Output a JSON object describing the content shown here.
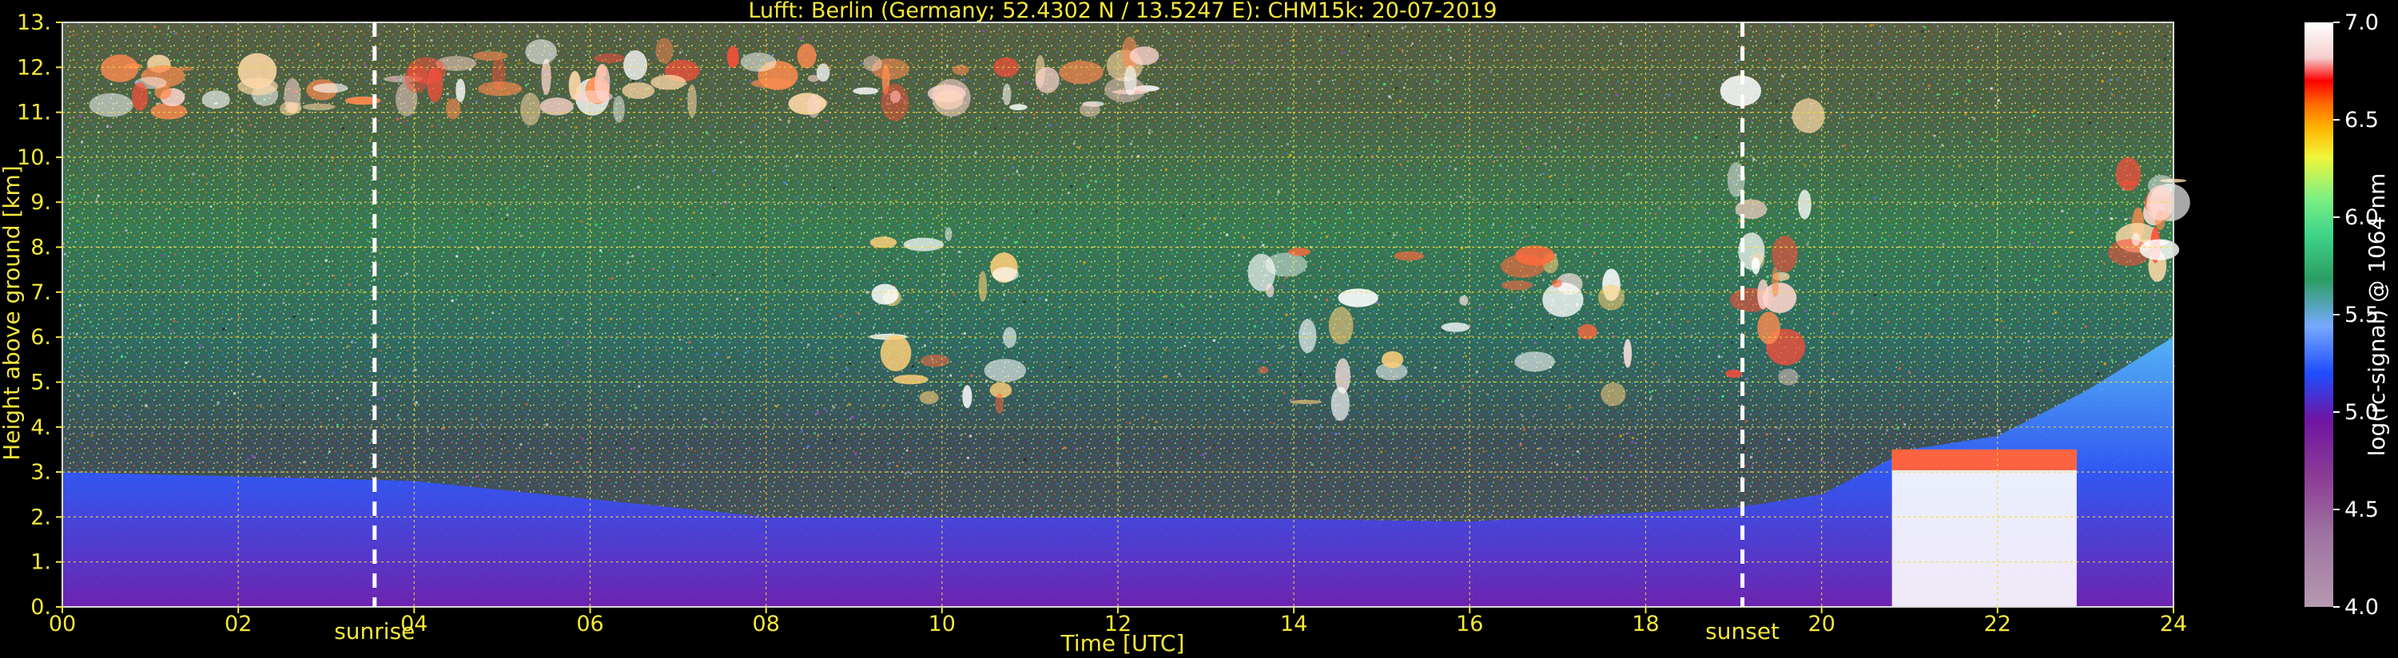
{
  "chart_data": {
    "type": "heatmap",
    "title": "Lufft: Berlin (Germany; 52.4302 N / 13.5247 E):    CHM15k: 20-07-2019",
    "xlabel": "Time [UTC]",
    "ylabel": "Height above ground [km]",
    "xlim": [
      0,
      24
    ],
    "ylim": [
      0,
      13
    ],
    "x_ticks": [
      "00",
      "02",
      "04",
      "06",
      "08",
      "10",
      "12",
      "14",
      "16",
      "18",
      "20",
      "22",
      "24"
    ],
    "y_ticks": [
      "0.",
      "1.",
      "2.",
      "3.",
      "4.",
      "5.",
      "6.",
      "7.",
      "8.",
      "9.",
      "10.",
      "11.",
      "12.",
      "13."
    ],
    "colorbar": {
      "label": "log(rc-signal) @ 1064 nm",
      "range": [
        4.0,
        7.0
      ],
      "ticks": [
        "4.0",
        "4.5",
        "5.0",
        "5.5",
        "6.0",
        "6.5",
        "7.0"
      ]
    },
    "grid": true,
    "annotations": [
      {
        "label": "sunrise",
        "x": 3.55
      },
      {
        "label": "sunset",
        "x": 19.1
      }
    ],
    "cloud_layers": [
      {
        "x_start": 0.0,
        "x_end": 12.5,
        "y_bottom": 11.0,
        "y_top": 12.4,
        "intensity": 6.6
      },
      {
        "x_start": 9.3,
        "x_end": 10.8,
        "y_bottom": 4.4,
        "y_top": 8.4,
        "intensity": 6.8
      },
      {
        "x_start": 13.6,
        "x_end": 17.8,
        "y_bottom": 4.5,
        "y_top": 8.0,
        "intensity": 6.7
      },
      {
        "x_start": 19.0,
        "x_end": 19.9,
        "y_bottom": 5.0,
        "y_top": 11.5,
        "intensity": 6.5
      },
      {
        "x_start": 23.4,
        "x_end": 24.0,
        "y_bottom": 7.0,
        "y_top": 10.0,
        "intensity": 6.4
      }
    ],
    "boundary_layer": [
      {
        "x": 0,
        "top": 3.0
      },
      {
        "x": 4,
        "top": 2.8
      },
      {
        "x": 8,
        "top": 2.0
      },
      {
        "x": 12,
        "top": 2.0
      },
      {
        "x": 16,
        "top": 1.9
      },
      {
        "x": 19,
        "top": 2.2
      },
      {
        "x": 20,
        "top": 2.5
      },
      {
        "x": 21,
        "top": 3.5
      },
      {
        "x": 22,
        "top": 3.8
      },
      {
        "x": 23,
        "top": 4.8
      },
      {
        "x": 24,
        "top": 6.0
      }
    ]
  }
}
